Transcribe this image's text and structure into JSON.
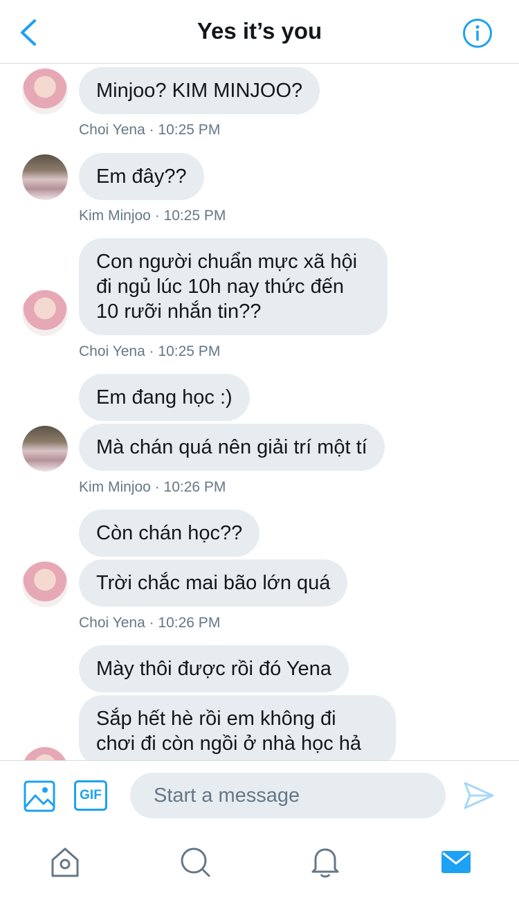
{
  "header": {
    "title": "Yes it’s you"
  },
  "messages": [
    {
      "sender": "Choi Yena",
      "texts": [
        "Minjoo? KIM MINJOO?"
      ],
      "meta": "Choi Yena · 10:25 PM"
    },
    {
      "sender": "Kim Minjoo",
      "texts": [
        "Em đây??"
      ],
      "meta": "Kim Minjoo · 10:25 PM"
    },
    {
      "sender": "Choi Yena",
      "texts": [
        "Con người chuẩn mực xã hội đi ngủ lúc 10h nay thức đến 10 rưỡi nhắn tin??"
      ],
      "meta": "Choi Yena · 10:25 PM"
    },
    {
      "sender": "Kim Minjoo",
      "texts": [
        "Em đang học :)",
        "Mà chán quá nên giải trí một tí"
      ],
      "meta": "Kim Minjoo · 10:26 PM"
    },
    {
      "sender": "Choi Yena",
      "texts": [
        "Còn chán học??",
        "Trời chắc mai bão lớn quá"
      ],
      "meta": "Choi Yena · 10:26 PM"
    },
    {
      "sender": "Choi Yena",
      "texts": [
        "Mày thôi được rồi đó Yena",
        "Sắp hết hè rồi em không đi chơi đi còn ngồi ở nhà học hả"
      ]
    }
  ],
  "composer": {
    "gif_label": "GIF",
    "placeholder": "Start a message"
  },
  "icons": {
    "back": "chevron-left-icon",
    "info": "info-icon",
    "image": "image-icon",
    "send": "send-icon",
    "home": "home-icon",
    "search": "search-icon",
    "notifications": "bell-icon",
    "messages": "mail-icon"
  },
  "colors": {
    "accent": "#1da1f2",
    "bubble": "#e6ecf0",
    "meta": "#657786",
    "text": "#14171a"
  }
}
